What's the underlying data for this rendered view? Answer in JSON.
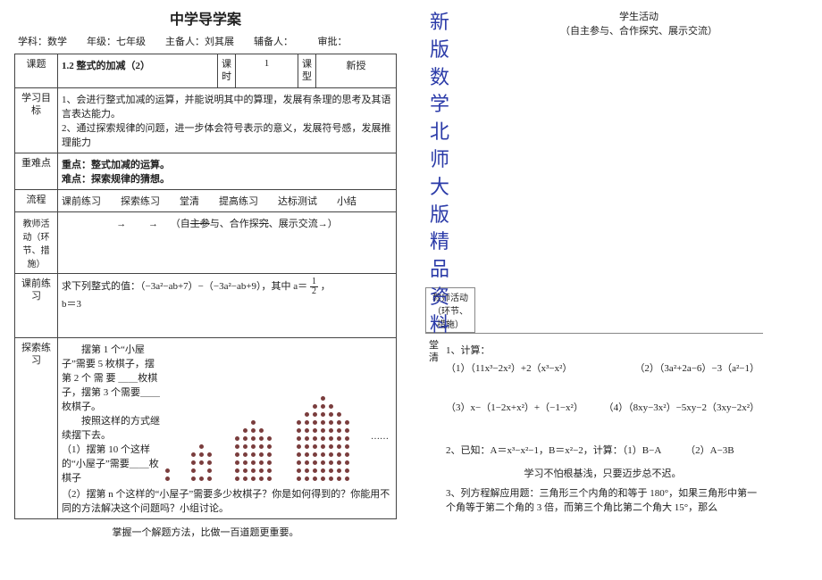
{
  "title": "中学导学案",
  "meta": "学科：数学　　年级：七年级　　主备人：刘其展　　辅备人：　　　审批：",
  "row1": {
    "c1": "课题",
    "c2": "1.2  整式的加减（2）",
    "c3": "课时",
    "c4": "1",
    "c5": "课型",
    "c6": "新授"
  },
  "goals": {
    "label": "学习目标",
    "body": "1、会进行整式加减的运算，并能说明其中的算理，发展有条理的思考及其语言表达能力。\n2、通过探索规律的问题，进一步体会符号表示的意义，发展符号感，发展推理能力"
  },
  "focus": {
    "label": "重难点",
    "l1": "重点：整式加减的运算。",
    "l2": "难点：探索规律的猜想。"
  },
  "flow": {
    "label": "流程",
    "body": "课前练习　　探索练习　　堂清　　提高练习　　达标测试　　小结"
  },
  "act": {
    "left": "教师活动（环节、措施）",
    "right": "学生活动\n（自主参与、合作探究、展示交流）"
  },
  "pre": {
    "label": "课前练习",
    "line1": "求下列整式的值：（−3a²−ab+7）−（−3a²−ab+9），其中 a＝",
    "line2": "，",
    "line3": "b＝3"
  },
  "exp": {
    "label": "探索练习",
    "p1": "　　摆第 1 个“小屋子”需要 5 枚棋子，摆 第 2 个 需 要 ＿＿枚棋子，摆第 3 个需要＿＿枚棋子。",
    "p2": "　　按照这样的方式继续摆下去。",
    "p3": "（1）摆第 10 个这样的“小屋子”需要＿＿枚棋子",
    "p4": "（2）摆第 n 个这样的“小屋子”需要多少枚棋子？你是如何得到的？你能用不同的方法解决这个问题吗？小组讨论。"
  },
  "footer_left": "掌握一个解题方法，比做一百道题更重要。",
  "banner": "新版数学北师大版精品资料",
  "r_act_head": "学生活动",
  "r_act_sub": "（自主参与、合作探究、展示交流）",
  "teacher_box": "教师活动（环节、措施）",
  "tq": {
    "label": "堂清",
    "h1": "1、计算：",
    "p1a": "（1）（11x³−2x²）+2（x³−x²）",
    "p1b": "（2）（3a²+2a−6）−3（a²−1）",
    "p2a": "（3）x−（1−2x+x²）+（−1−x²）",
    "p2b": "（4）（8xy−3x²）−5xy−2（3xy−2x²）",
    "h2": "2、已知：A＝x³−x²−1，B＝x²−2，计算：（1）B−A　　　（2）A−3B",
    "footer": "学习不怕根基浅，只要迈步总不迟。",
    "h3": "3、列方程解应用题：三角形三个内角的和等于 180°，如果三角形中第一个角等于第二个角的 3 倍，而第三个角比第二个角大 15°，那么"
  }
}
